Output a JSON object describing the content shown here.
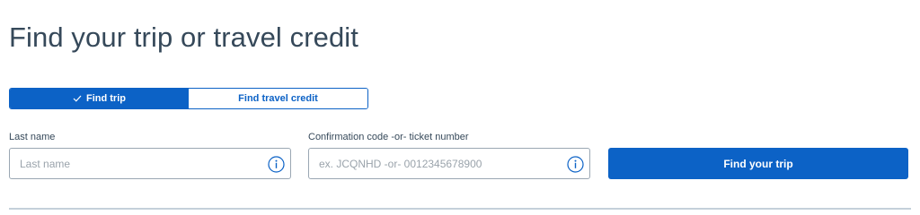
{
  "page": {
    "title": "Find your trip or travel credit"
  },
  "toggle": {
    "find_trip_label": "Find trip",
    "find_credit_label": "Find travel credit",
    "active": "find_trip"
  },
  "form": {
    "last_name": {
      "label": "Last name",
      "value": "",
      "placeholder": "Last name"
    },
    "confirmation": {
      "label": "Confirmation code -or- ticket number",
      "value": "",
      "placeholder": "ex. JCQNHD -or- 0012345678900"
    },
    "submit_label": "Find your trip"
  },
  "icons": {
    "check": "check-icon",
    "info": "info-icon"
  },
  "colors": {
    "primary": "#0c62c6",
    "text": "#36495a",
    "border": "#9aa7b3",
    "divider": "#c4d0da"
  }
}
